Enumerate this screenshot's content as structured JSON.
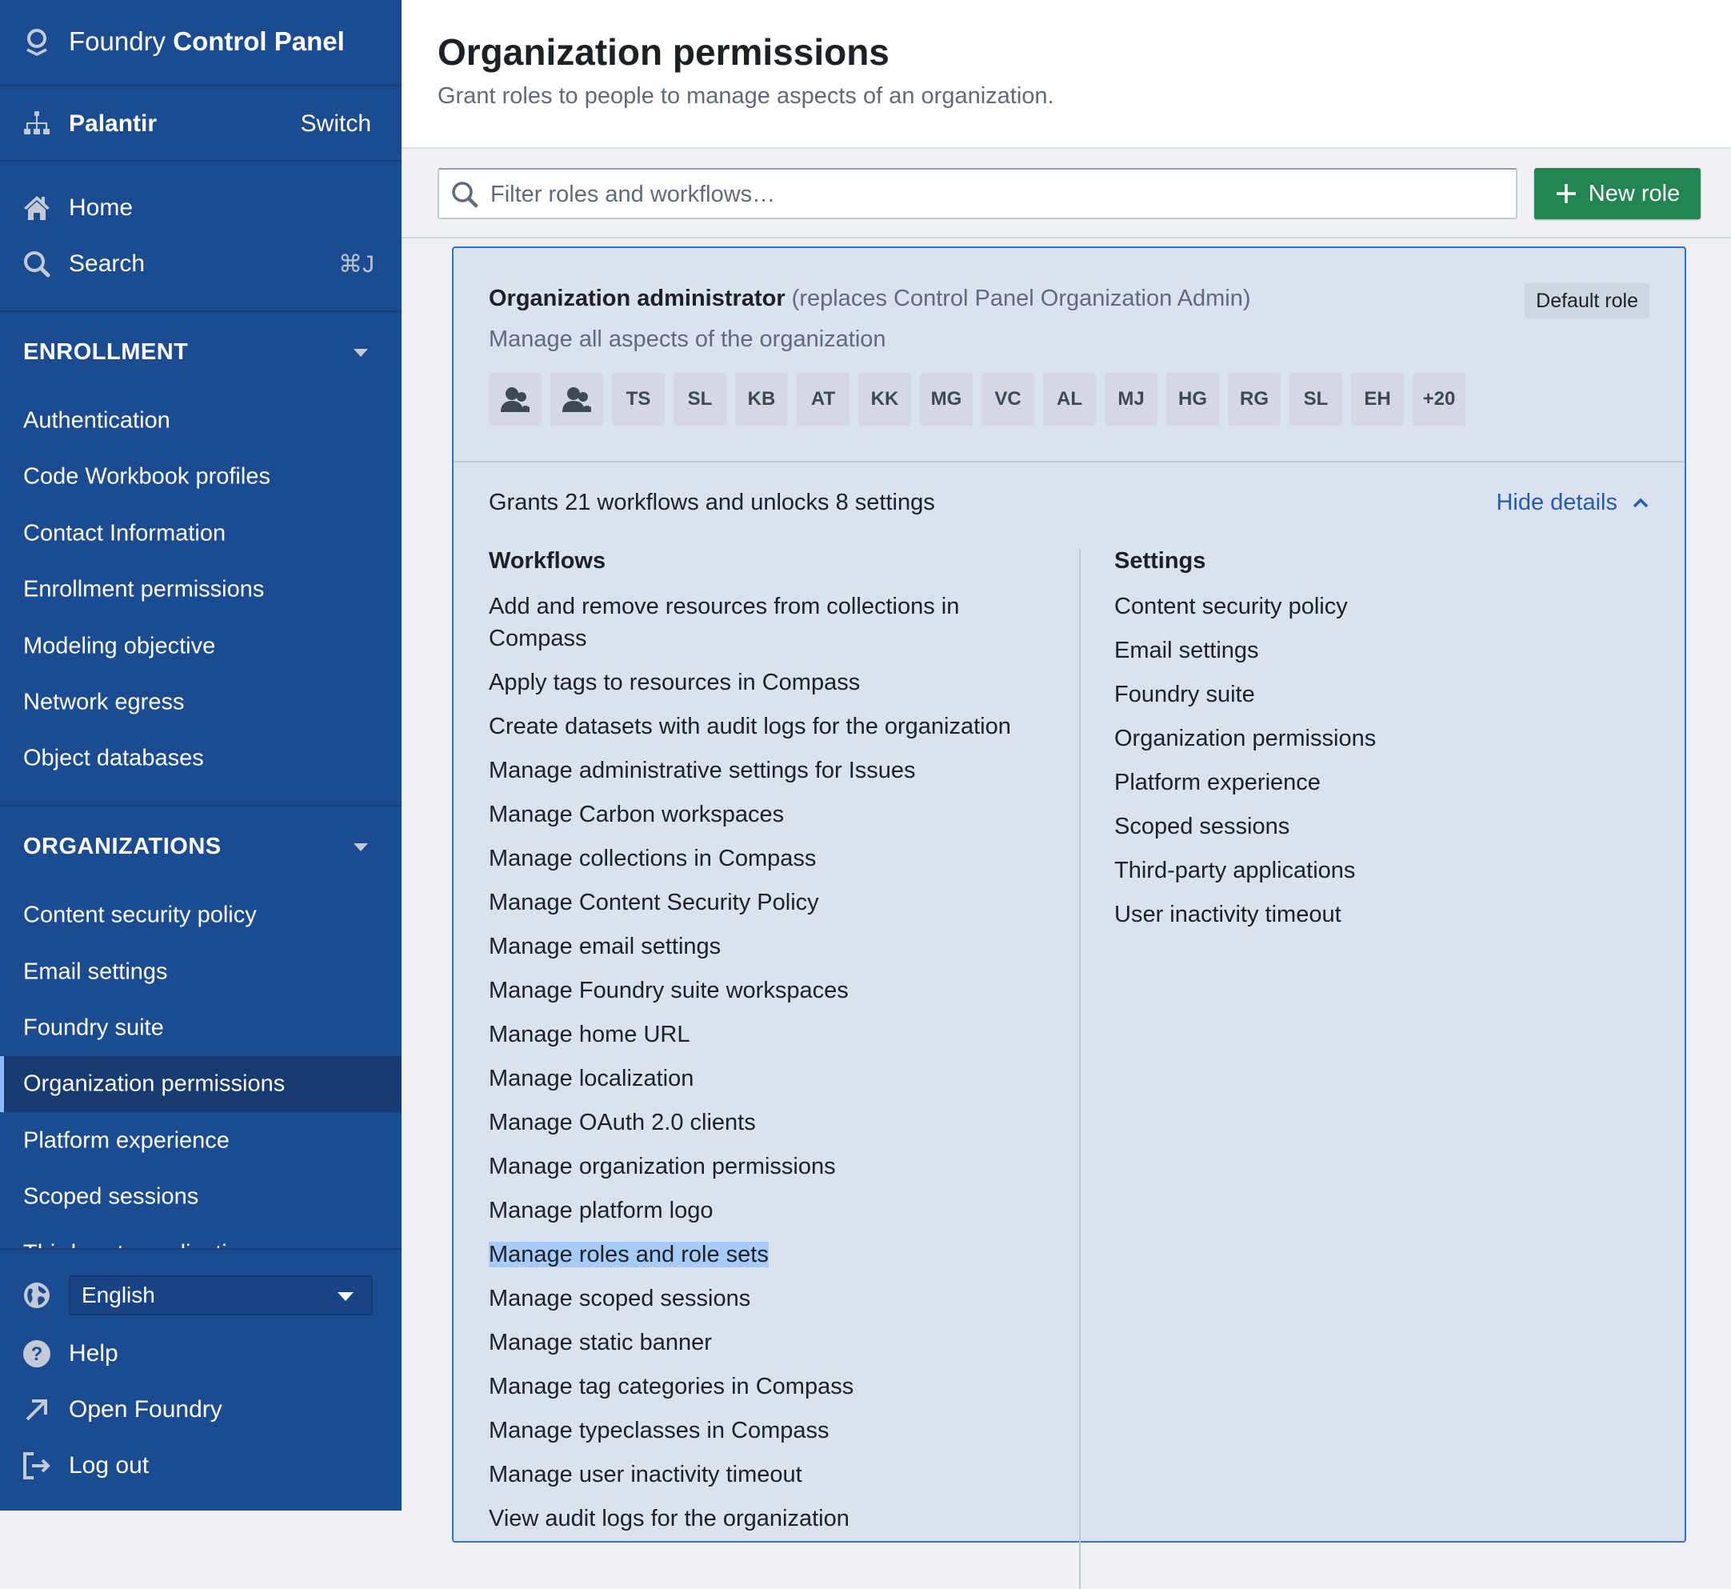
{
  "app": {
    "title_regular": "Foundry",
    "title_bold": "Control Panel",
    "logo_icon": "palantir-logo-icon"
  },
  "org": {
    "name": "Palantir",
    "switch_label": "Switch",
    "icon": "org-hierarchy-icon"
  },
  "nav": {
    "home": "Home",
    "search": "Search",
    "search_shortcut": "⌘J"
  },
  "sections": [
    {
      "title": "ENROLLMENT",
      "items": [
        "Authentication",
        "Code Workbook profiles",
        "Contact Information",
        "Enrollment permissions",
        "Modeling objective",
        "Network egress",
        "Object databases"
      ]
    },
    {
      "title": "ORGANIZATIONS",
      "items": [
        "Content security policy",
        "Email settings",
        "Foundry suite",
        "Organization permissions",
        "Platform experience",
        "Scoped sessions",
        "Third-party applications"
      ],
      "active": "Organization permissions"
    }
  ],
  "footer": {
    "language": "English",
    "help": "Help",
    "open_foundry": "Open Foundry",
    "log_out": "Log out"
  },
  "page": {
    "title": "Organization permissions",
    "subtitle": "Grant roles to people to manage aspects of an organization."
  },
  "toolbar": {
    "search_placeholder": "Filter roles and workflows…",
    "search_value": "",
    "new_role_label": "New role"
  },
  "role": {
    "name": "Organization administrator",
    "replaces": "(replaces Control Panel Organization Admin)",
    "tag": "Default role",
    "description": "Manage all aspects of the organization",
    "members": [
      "group-icon",
      "group-icon",
      "TS",
      "SL",
      "KB",
      "AT",
      "KK",
      "MG",
      "VC",
      "AL",
      "MJ",
      "HG",
      "RG",
      "SL",
      "EH",
      "+20"
    ],
    "summary": "Grants 21 workflows and unlocks 8 settings",
    "hide_details_label": "Hide details",
    "workflows_heading": "Workflows",
    "settings_heading": "Settings",
    "workflows": [
      "Add and remove resources from collections in Compass",
      "Apply tags to resources in Compass",
      "Create datasets with audit logs for the organization",
      "Manage administrative settings for Issues",
      "Manage Carbon workspaces",
      "Manage collections in Compass",
      "Manage Content Security Policy",
      "Manage email settings",
      "Manage Foundry suite workspaces",
      "Manage home URL",
      "Manage localization",
      "Manage OAuth 2.0 clients",
      "Manage organization permissions",
      "Manage platform logo",
      "Manage roles and role sets",
      "Manage scoped sessions",
      "Manage static banner",
      "Manage tag categories in Compass",
      "Manage typeclasses in Compass",
      "Manage user inactivity timeout",
      "View audit logs for the organization"
    ],
    "highlighted_workflow": "Manage roles and role sets",
    "settings": [
      "Content security policy",
      "Email settings",
      "Foundry suite",
      "Organization permissions",
      "Platform experience",
      "Scoped sessions",
      "Third-party applications",
      "User inactivity timeout"
    ]
  },
  "colors": {
    "sidebar_bg": "#1b4b90",
    "sidebar_active_bg": "#173a70",
    "accent_blue": "#2d72d2",
    "link_blue": "#215db0",
    "primary_green": "#238551",
    "card_bg": "#dbe1ee",
    "selection": "#a7cbf7"
  }
}
